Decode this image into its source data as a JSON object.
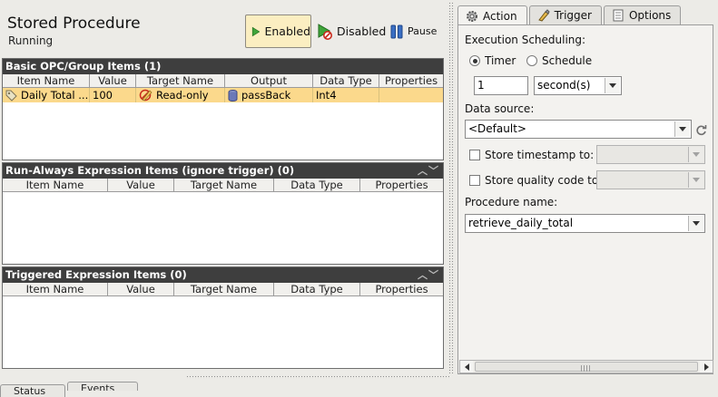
{
  "header": {
    "title": "Stored Procedure",
    "status": "Running"
  },
  "controls": {
    "enabled": "Enabled",
    "disabled": "Disabled",
    "pause": "Pause"
  },
  "tables": {
    "basic": {
      "title": "Basic OPC/Group Items (1)",
      "columns": [
        "Item Name",
        "Value",
        "Target Name",
        "Output",
        "Data Type",
        "Properties"
      ],
      "rows": [
        {
          "item_name": "Daily Total ...",
          "value": "100",
          "target": "Read-only",
          "output": "passBack",
          "data_type": "Int4",
          "properties": ""
        }
      ]
    },
    "runalways": {
      "title": "Run-Always Expression Items (ignore trigger) (0)",
      "columns": [
        "Item Name",
        "Value",
        "Target Name",
        "Data Type",
        "Properties"
      ]
    },
    "triggered": {
      "title": "Triggered Expression Items (0)",
      "columns": [
        "Item Name",
        "Value",
        "Target Name",
        "Data Type",
        "Properties"
      ]
    }
  },
  "tabs": [
    "Action",
    "Trigger",
    "Options"
  ],
  "action": {
    "scheduling_label": "Execution Scheduling:",
    "timer_label": "Timer",
    "schedule_label": "Schedule",
    "interval_value": "1",
    "interval_unit": "second(s)",
    "datasource_label": "Data source:",
    "datasource_value": "<Default>",
    "store_timestamp_label": "Store timestamp to:",
    "store_quality_label": "Store quality code to:",
    "procedure_label": "Procedure name:",
    "procedure_value": "retrieve_daily_total"
  },
  "bottom_tabs": [
    "Status",
    "Events"
  ],
  "colors": {
    "selected_row": "#fbd98c",
    "panel_header": "#3e3e3e",
    "enabled_bg": "#fbeec1"
  },
  "icons": [
    "play-icon",
    "disabled-icon",
    "pause-icon",
    "tag-icon",
    "readonly-icon",
    "database-icon",
    "gear-icon",
    "trigger-icon",
    "options-icon",
    "refresh-icon"
  ]
}
